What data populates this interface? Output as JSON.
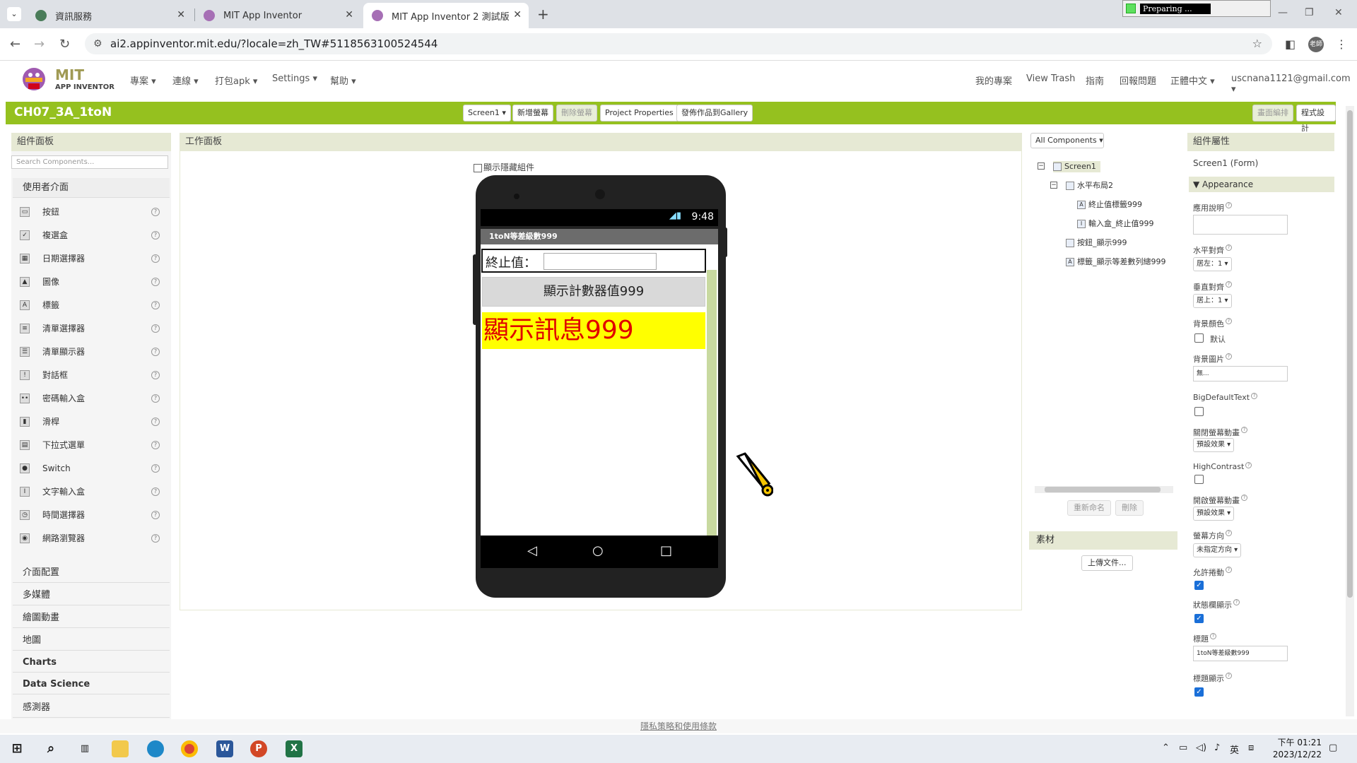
{
  "browser": {
    "tabs": [
      {
        "title": "資訊服務"
      },
      {
        "title": "MIT App Inventor"
      },
      {
        "title": "MIT App Inventor 2 測試版"
      }
    ],
    "url": "ai2.appinventor.mit.edu/?locale=zh_TW#5118563100524544",
    "preparing_label": "Preparing ...",
    "profile_label": "老師"
  },
  "app_header": {
    "logo_title": "MIT",
    "logo_subtitle": "APP INVENTOR",
    "menus": [
      "專案 ▾",
      "連線 ▾",
      "打包apk ▾",
      "Settings ▾",
      "幫助 ▾"
    ],
    "right_menus": [
      "我的專案",
      "View Trash",
      "指南",
      "回報問題",
      "正體中文 ▾",
      "uscnana1121@gmail.com ▾"
    ]
  },
  "toolbar": {
    "project_name": "CH07_3A_1toN",
    "screen_select": "Screen1 ▾",
    "add_screen": "新增螢幕",
    "remove_screen": "刪除螢幕",
    "project_properties": "Project Properties",
    "publish_gallery": "發佈作品到Gallery",
    "designer": "畫面編排",
    "blocks": "程式設計"
  },
  "palette": {
    "title": "組件面板",
    "search_placeholder": "Search Components...",
    "open_category": "使用者介面",
    "items": [
      {
        "label": "按鈕",
        "icon": "button-icon",
        "glyph": "▭"
      },
      {
        "label": "複選盒",
        "icon": "checkbox-icon",
        "glyph": "✓"
      },
      {
        "label": "日期選擇器",
        "icon": "datepicker-icon",
        "glyph": "▦"
      },
      {
        "label": "圖像",
        "icon": "image-icon",
        "glyph": "▲"
      },
      {
        "label": "標籤",
        "icon": "label-icon",
        "glyph": "A"
      },
      {
        "label": "清單選擇器",
        "icon": "listpicker-icon",
        "glyph": "≡"
      },
      {
        "label": "清單顯示器",
        "icon": "listview-icon",
        "glyph": "☰"
      },
      {
        "label": "對話框",
        "icon": "notifier-icon",
        "glyph": "!"
      },
      {
        "label": "密碼輸入盒",
        "icon": "password-icon",
        "glyph": "••"
      },
      {
        "label": "滑桿",
        "icon": "slider-icon",
        "glyph": "▮"
      },
      {
        "label": "下拉式選單",
        "icon": "spinner-icon",
        "glyph": "▤"
      },
      {
        "label": "Switch",
        "icon": "switch-icon",
        "glyph": "●"
      },
      {
        "label": "文字輸入盒",
        "icon": "textbox-icon",
        "glyph": "I"
      },
      {
        "label": "時間選擇器",
        "icon": "timepicker-icon",
        "glyph": "◷"
      },
      {
        "label": "網路瀏覽器",
        "icon": "webviewer-icon",
        "glyph": "◉"
      }
    ],
    "categories": [
      "介面配置",
      "多媒體",
      "繪圖動畫",
      "地圖",
      "Charts",
      "Data Science",
      "感測器"
    ]
  },
  "viewer": {
    "title": "工作面板",
    "show_hidden": "顯示隱藏組件",
    "phone_time": "9:48",
    "screen_title": "1toN等差級數999",
    "label_end": "終止值：",
    "button_text": "顯示計數器值999",
    "message_text": "顯示訊息999"
  },
  "components": {
    "dropdown": "All Components ▾",
    "tree": [
      {
        "label": "Screen1"
      },
      {
        "label": "水平布局2"
      },
      {
        "label": "終止值標籤999"
      },
      {
        "label": "輸入盒_終止值999"
      },
      {
        "label": "按鈕_顯示999"
      },
      {
        "label": "標籤_顯示等差數列總999"
      }
    ],
    "rename": "重新命名",
    "delete": "刪除",
    "assets_title": "素材",
    "upload": "上傳文件..."
  },
  "properties": {
    "title": "組件屬性",
    "subject": "Screen1 (Form)",
    "section": "Appearance",
    "fields": {
      "about": "應用說明",
      "align_h": "水平對齊",
      "align_h_val": "居左：1 ▾",
      "align_v": "垂直對齊",
      "align_v_val": "居上：1 ▾",
      "bg_color": "背景顏色",
      "bg_color_val": "默认",
      "bg_image": "背景圖片",
      "bg_image_val": "無...",
      "big_default_text": "BigDefaultText",
      "close_anim": "關閉螢幕動畫",
      "close_anim_val": "預設效果 ▾",
      "high_contrast": "HighContrast",
      "open_anim": "開啟螢幕動畫",
      "open_anim_val": "預設效果 ▾",
      "orientation": "螢幕方向",
      "orientation_val": "未指定方向 ▾",
      "scrollable": "允許捲動",
      "show_status": "狀態欄顯示",
      "title_label": "標題",
      "title_val": "1toN等差級數999",
      "title_visible": "標題顯示"
    },
    "scrollable_checked": true,
    "show_status_checked": true,
    "title_visible_checked": true,
    "big_default_checked": false,
    "high_contrast_checked": false
  },
  "footer": {
    "privacy": "隱私策略和使用條款"
  },
  "taskbar": {
    "ime": "英",
    "time": "下午 01:21",
    "date": "2023/12/22"
  },
  "colors": {
    "brand_green": "#95c11f",
    "message_bg": "#ffff00",
    "message_fg": "#e00000"
  }
}
